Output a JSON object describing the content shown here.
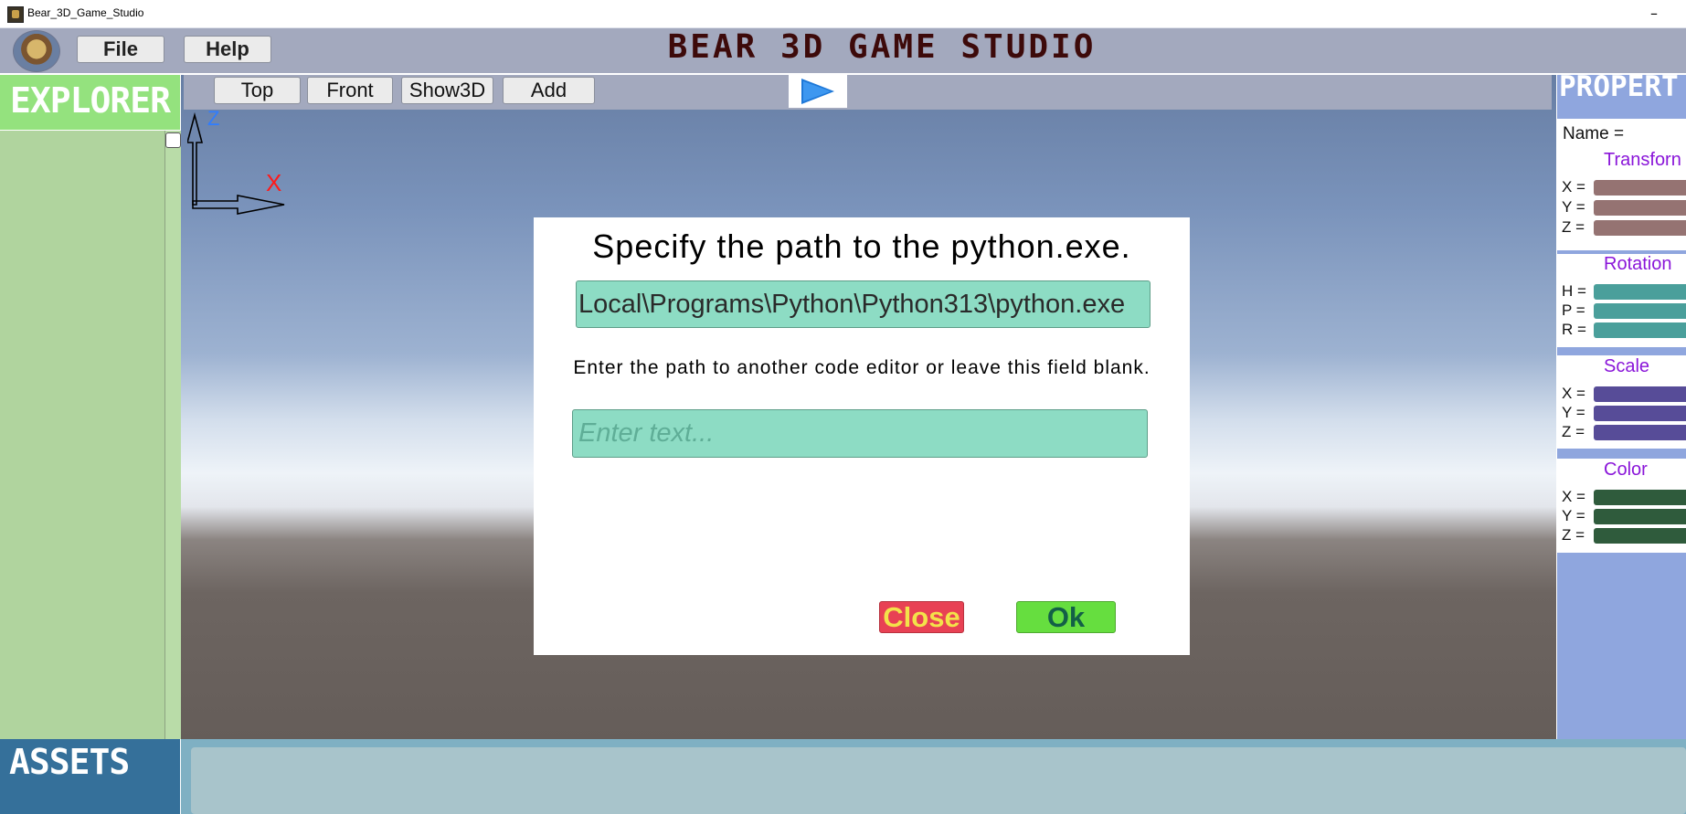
{
  "window": {
    "title": "Bear_3D_Game_Studio",
    "minimize_glyph": "–"
  },
  "menu": {
    "file_label": "File",
    "help_label": "Help"
  },
  "app_title": "BEAR 3D GAME STUDIO",
  "explorer": {
    "title": "EXPLORER"
  },
  "view_toolbar": {
    "top_label": "Top",
    "front_label": "Front",
    "show3d_label": "Show3D",
    "add_label": "Add",
    "play_icon": "play-icon"
  },
  "axes": {
    "z_label": "Z",
    "x_label": "X"
  },
  "properties": {
    "title": "PROPERT",
    "name_label": "Name =",
    "transform": {
      "heading": "Transforn",
      "labels": [
        "X =",
        "Y =",
        "Z ="
      ],
      "field_color": "#957372"
    },
    "rotation": {
      "heading": "Rotation",
      "labels": [
        "H =",
        "P =",
        "R ="
      ],
      "field_color": "#4a9f9b"
    },
    "scale": {
      "heading": "Scale",
      "labels": [
        "X =",
        "Y =",
        "Z ="
      ],
      "field_color": "#574c98"
    },
    "color": {
      "heading": "Color",
      "labels": [
        "X =",
        "Y =",
        "Z ="
      ],
      "field_color": "#2f5b3c"
    }
  },
  "assets": {
    "title": "ASSETS"
  },
  "dialog": {
    "title": "Specify the path to the python.exe.",
    "python_path_value": "Local\\Programs\\Python\\Python313\\python.exe",
    "editor_label": "Enter the path to another code editor or leave this field blank.",
    "editor_placeholder": "Enter text...",
    "close_label": "Close",
    "ok_label": "Ok"
  }
}
